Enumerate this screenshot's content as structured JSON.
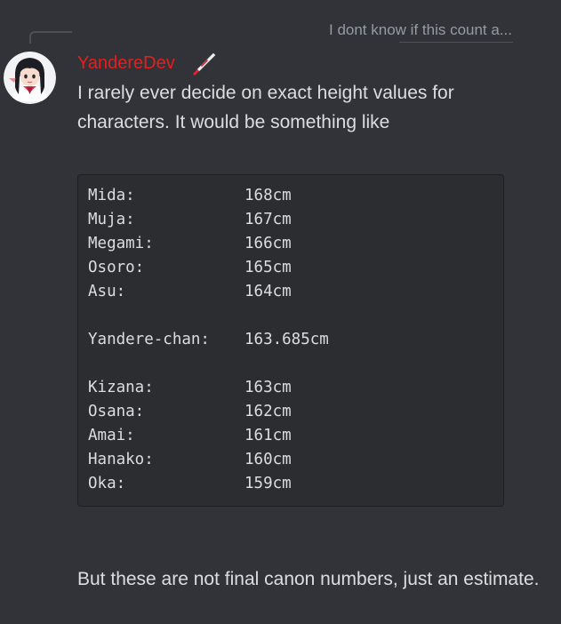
{
  "reply": {
    "preview_text": "I dont know if this count a..."
  },
  "message": {
    "author": "YandereDev",
    "author_color": "#e61e1e",
    "text": "I rarely ever decide on exact height values for characters. It would be something like",
    "footer_text": "But these are not final canon numbers, just an estimate."
  },
  "codeblock": {
    "group1": [
      {
        "name": "Mida:",
        "height": "168cm"
      },
      {
        "name": "Muja:",
        "height": "167cm"
      },
      {
        "name": "Megami:",
        "height": "166cm"
      },
      {
        "name": "Osoro:",
        "height": "165cm"
      },
      {
        "name": "Asu:",
        "height": "164cm"
      }
    ],
    "group2": [
      {
        "name": "Yandere-chan:",
        "height": "163.685cm"
      }
    ],
    "group3": [
      {
        "name": "Kizana:",
        "height": "163cm"
      },
      {
        "name": "Osana:",
        "height": "162cm"
      },
      {
        "name": "Amai:",
        "height": "161cm"
      },
      {
        "name": "Hanako:",
        "height": "160cm"
      },
      {
        "name": "Oka:",
        "height": "159cm"
      }
    ]
  },
  "icons": {
    "role": "knife-icon",
    "avatar": "user-avatar"
  }
}
